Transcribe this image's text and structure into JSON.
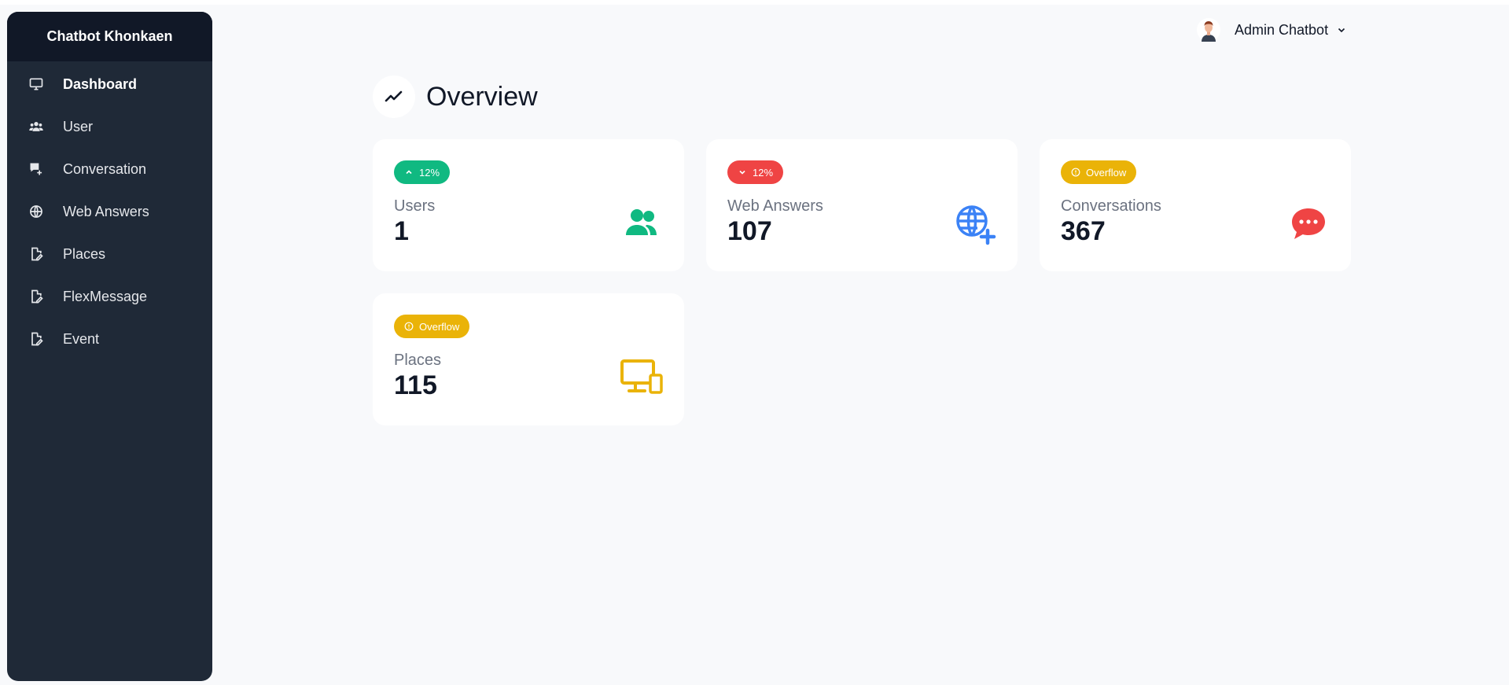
{
  "sidebar": {
    "brand": "Chatbot Khonkaen",
    "items": [
      {
        "label": "Dashboard",
        "icon": "monitor-icon",
        "active": true
      },
      {
        "label": "User",
        "icon": "users-icon"
      },
      {
        "label": "Conversation",
        "icon": "conversation-icon"
      },
      {
        "label": "Web Answers",
        "icon": "globe-icon"
      },
      {
        "label": "Places",
        "icon": "file-edit-icon"
      },
      {
        "label": "FlexMessage",
        "icon": "file-edit-icon"
      },
      {
        "label": "Event",
        "icon": "file-edit-icon"
      }
    ]
  },
  "header": {
    "user_name": "Admin Chatbot"
  },
  "main": {
    "title": "Overview",
    "cards": [
      {
        "badge": "12%",
        "badge_type": "up",
        "badge_color": "#10b981",
        "label": "Users",
        "value": "1",
        "icon": "users-icon",
        "icon_color": "#10b981"
      },
      {
        "badge": "12%",
        "badge_type": "down",
        "badge_color": "#ef4444",
        "label": "Web Answers",
        "value": "107",
        "icon": "globe-plus-icon",
        "icon_color": "#3b82f6"
      },
      {
        "badge": "Overflow",
        "badge_type": "info",
        "badge_color": "#eab308",
        "label": "Conversations",
        "value": "367",
        "icon": "chat-bubble-icon",
        "icon_color": "#ef4444"
      },
      {
        "badge": "Overflow",
        "badge_type": "info",
        "badge_color": "#eab308",
        "label": "Places",
        "value": "115",
        "icon": "devices-icon",
        "icon_color": "#eab308"
      }
    ]
  }
}
